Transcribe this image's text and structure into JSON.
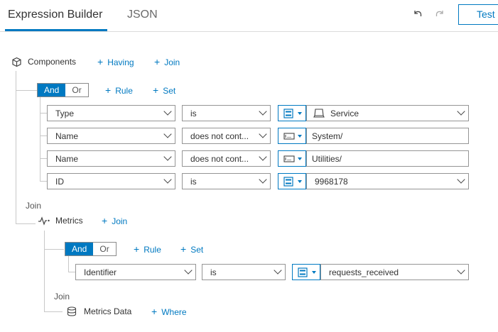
{
  "tabs": [
    {
      "label": "Expression Builder",
      "active": true
    },
    {
      "label": "JSON",
      "active": false
    }
  ],
  "header": {
    "undo_icon": "undo-icon",
    "redo_icon": "redo-icon",
    "test_label": "Test"
  },
  "colors": {
    "accent": "#0079c1",
    "line": "#c8c8c8",
    "border": "#959595"
  },
  "components": {
    "label": "Components",
    "icon": "cube-icon",
    "having_label": "Having",
    "join_label": "Join",
    "group": {
      "and_label": "And",
      "or_label": "Or",
      "active": "And",
      "rule_label": "Rule",
      "set_label": "Set"
    },
    "rules": [
      {
        "field": "Type",
        "operator": "is",
        "mode_icon": "list-icon",
        "value": "Service",
        "value_icon": "service-icon",
        "value_type": "select"
      },
      {
        "field": "Name",
        "operator": "does not cont...",
        "mode_icon": "text-input-icon",
        "value": "System/",
        "value_type": "text"
      },
      {
        "field": "Name",
        "operator": "does not cont...",
        "mode_icon": "text-input-icon",
        "value": "Utilities/",
        "value_type": "text"
      },
      {
        "field": "ID",
        "operator": "is",
        "mode_icon": "list-icon",
        "value": "9968178",
        "value_type": "select"
      }
    ]
  },
  "join1": {
    "label": "Join"
  },
  "metrics": {
    "label": "Metrics",
    "icon": "metrics-icon",
    "join_label": "Join",
    "group": {
      "and_label": "And",
      "or_label": "Or",
      "active": "And",
      "rule_label": "Rule",
      "set_label": "Set"
    },
    "rules": [
      {
        "field": "Identifier",
        "operator": "is",
        "mode_icon": "list-icon",
        "value": "requests_received",
        "value_type": "select"
      }
    ]
  },
  "join2": {
    "label": "Join"
  },
  "metrics_data": {
    "label": "Metrics Data",
    "icon": "database-icon",
    "where_label": "Where"
  }
}
